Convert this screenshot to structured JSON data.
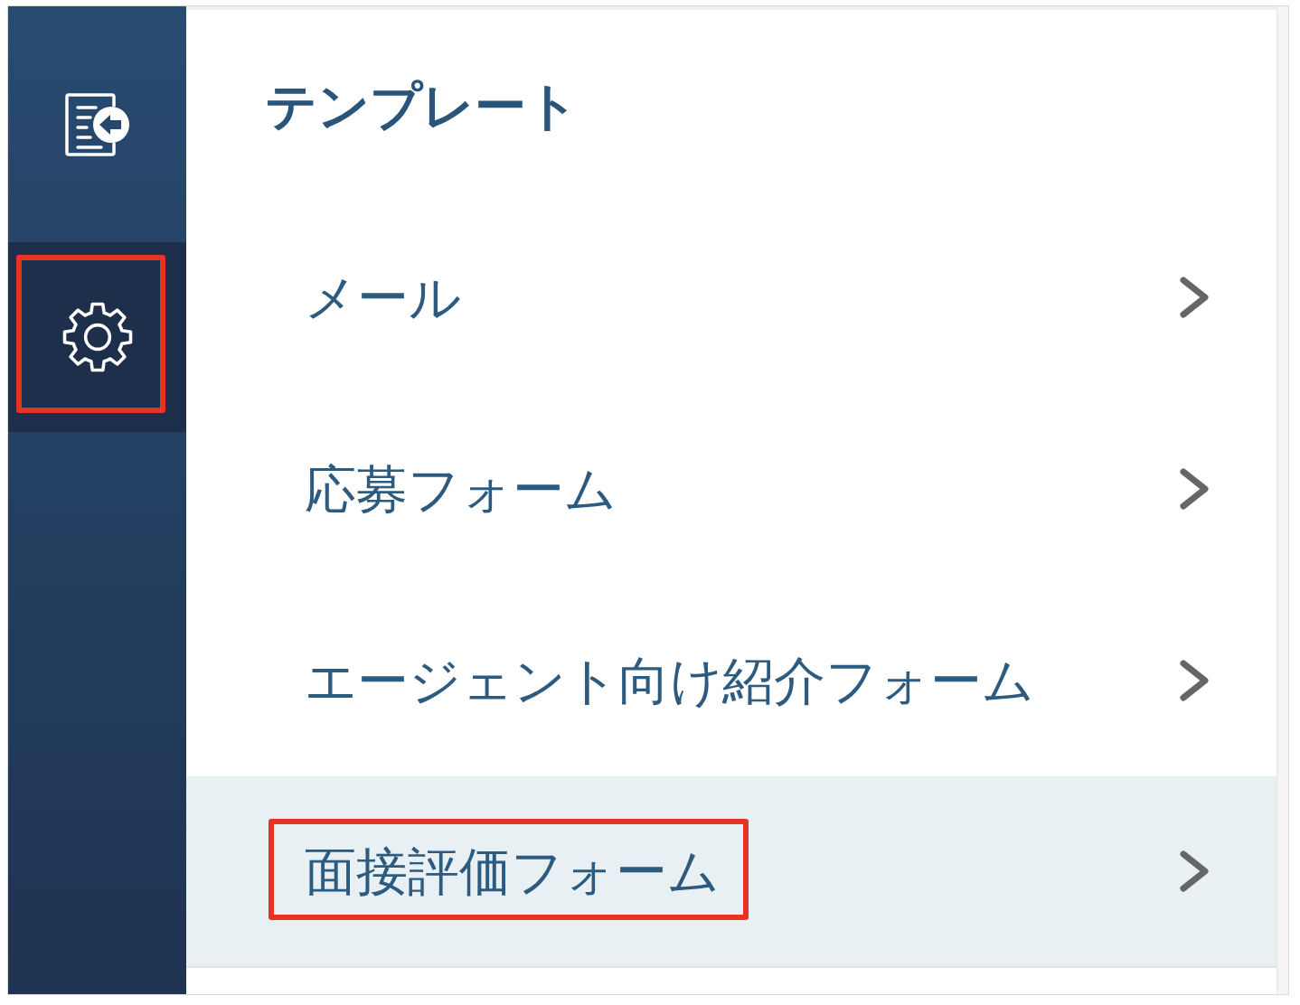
{
  "sidebar": {
    "items": [
      {
        "kind": "document",
        "selected": false,
        "highlighted": false
      },
      {
        "kind": "settings",
        "selected": true,
        "highlighted": true
      }
    ]
  },
  "page": {
    "title": "テンプレート"
  },
  "menu": {
    "items": [
      {
        "label": "メール",
        "selected": false,
        "highlighted": false
      },
      {
        "label": "応募フォーム",
        "selected": false,
        "highlighted": false
      },
      {
        "label": "エージェント向け紹介フォーム",
        "selected": false,
        "highlighted": false
      },
      {
        "label": "面接評価フォーム",
        "selected": true,
        "highlighted": true
      }
    ]
  }
}
